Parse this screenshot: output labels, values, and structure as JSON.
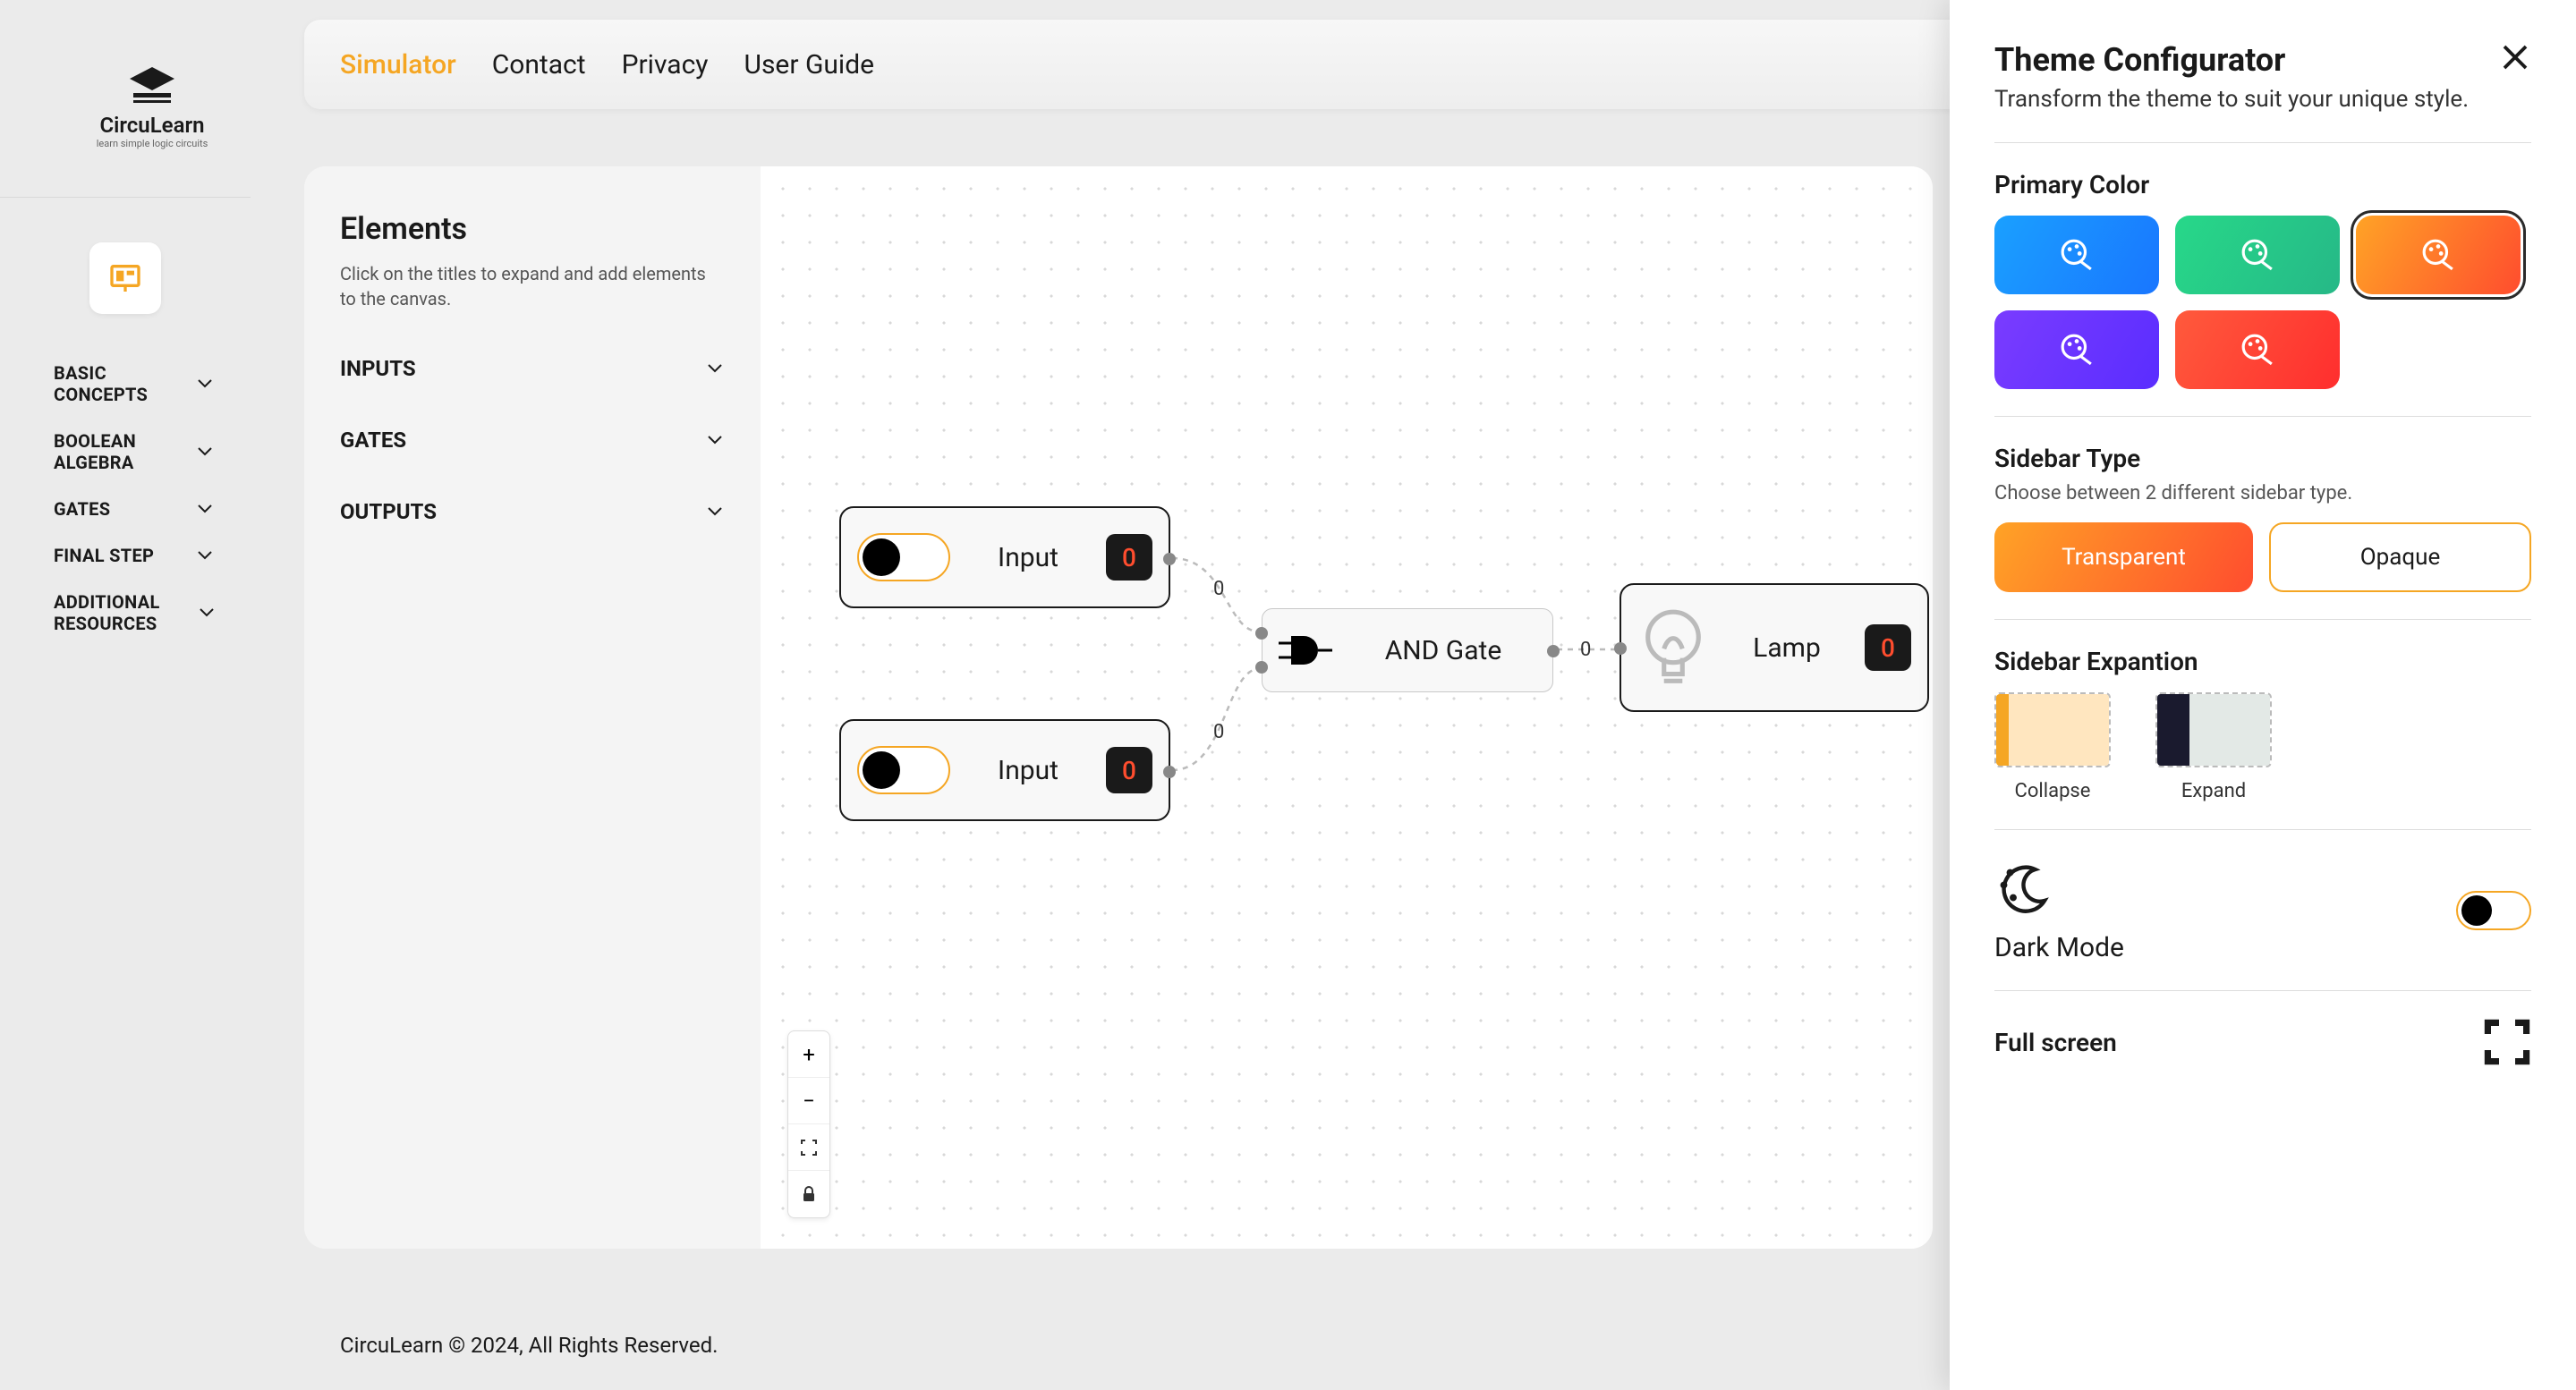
{
  "logo": {
    "name": "CircuLearn",
    "tagline": "learn simple logic circuits"
  },
  "nav": {
    "items": [
      {
        "label": "Simulator",
        "active": true
      },
      {
        "label": "Contact",
        "active": false
      },
      {
        "label": "Privacy",
        "active": false
      },
      {
        "label": "User Guide",
        "active": false
      }
    ]
  },
  "sidebar": {
    "items": [
      {
        "label": "BASIC CONCEPTS"
      },
      {
        "label": "BOOLEAN ALGEBRA"
      },
      {
        "label": "GATES"
      },
      {
        "label": "FINAL STEP"
      },
      {
        "label": "ADDITIONAL RESOURCES"
      }
    ]
  },
  "elements": {
    "title": "Elements",
    "desc": "Click on the titles to expand and add elements to the canvas.",
    "groups": [
      {
        "label": "INPUTS"
      },
      {
        "label": "GATES"
      },
      {
        "label": "OUTPUTS"
      }
    ]
  },
  "canvas": {
    "nodes": {
      "input1": {
        "label": "Input",
        "value": "0"
      },
      "input2": {
        "label": "Input",
        "value": "0"
      },
      "gate": {
        "label": "AND Gate"
      },
      "lamp": {
        "label": "Lamp",
        "value": "0"
      }
    },
    "wires": {
      "w1": "0",
      "w2": "0",
      "w3": "0"
    }
  },
  "footer": "CircuLearn © 2024, All Rights Reserved.",
  "theme": {
    "title": "Theme Configurator",
    "subtitle": "Transform the theme to suit your unique style.",
    "primaryColor": {
      "title": "Primary Color",
      "options": [
        "blue",
        "green",
        "orange",
        "purple",
        "red"
      ],
      "selected": "orange"
    },
    "sidebarType": {
      "title": "Sidebar Type",
      "desc": "Choose between 2 different sidebar type.",
      "options": {
        "transparent": "Transparent",
        "opaque": "Opaque"
      },
      "selected": "transparent"
    },
    "sidebarExpansion": {
      "title": "Sidebar Expantion",
      "options": {
        "collapse": "Collapse",
        "expand": "Expand"
      },
      "selected": "collapse"
    },
    "darkMode": {
      "label": "Dark Mode",
      "on": false
    },
    "fullscreen": {
      "label": "Full screen"
    }
  }
}
